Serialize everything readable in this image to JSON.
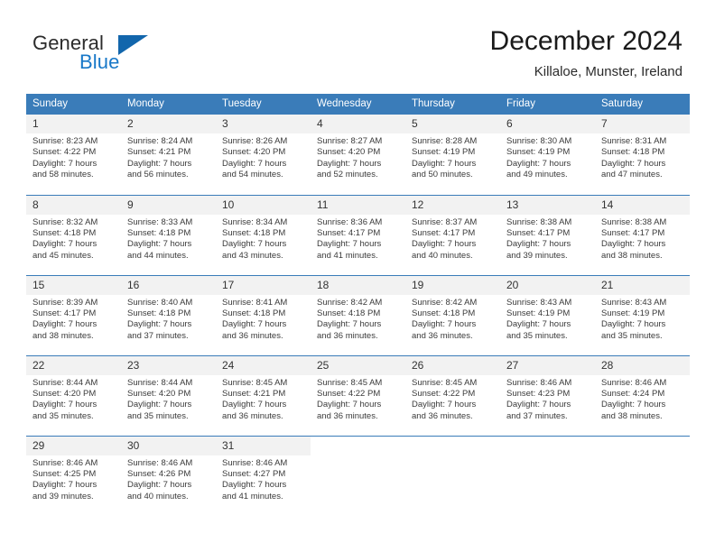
{
  "logo": {
    "line1": "General",
    "line2": "Blue",
    "triangle_color": "#1266ac",
    "blue_color": "#1878c8"
  },
  "header": {
    "title": "December 2024",
    "location": "Killaloe, Munster, Ireland"
  },
  "theme": {
    "header_blue": "#3a7cb9",
    "daynum_band": "#f2f2f2",
    "separator": "#3a7cb9"
  },
  "weekdays": [
    "Sunday",
    "Monday",
    "Tuesday",
    "Wednesday",
    "Thursday",
    "Friday",
    "Saturday"
  ],
  "weeks": [
    [
      {
        "day": "1",
        "sunrise": "Sunrise: 8:23 AM",
        "sunset": "Sunset: 4:22 PM",
        "daylight1": "Daylight: 7 hours",
        "daylight2": "and 58 minutes."
      },
      {
        "day": "2",
        "sunrise": "Sunrise: 8:24 AM",
        "sunset": "Sunset: 4:21 PM",
        "daylight1": "Daylight: 7 hours",
        "daylight2": "and 56 minutes."
      },
      {
        "day": "3",
        "sunrise": "Sunrise: 8:26 AM",
        "sunset": "Sunset: 4:20 PM",
        "daylight1": "Daylight: 7 hours",
        "daylight2": "and 54 minutes."
      },
      {
        "day": "4",
        "sunrise": "Sunrise: 8:27 AM",
        "sunset": "Sunset: 4:20 PM",
        "daylight1": "Daylight: 7 hours",
        "daylight2": "and 52 minutes."
      },
      {
        "day": "5",
        "sunrise": "Sunrise: 8:28 AM",
        "sunset": "Sunset: 4:19 PM",
        "daylight1": "Daylight: 7 hours",
        "daylight2": "and 50 minutes."
      },
      {
        "day": "6",
        "sunrise": "Sunrise: 8:30 AM",
        "sunset": "Sunset: 4:19 PM",
        "daylight1": "Daylight: 7 hours",
        "daylight2": "and 49 minutes."
      },
      {
        "day": "7",
        "sunrise": "Sunrise: 8:31 AM",
        "sunset": "Sunset: 4:18 PM",
        "daylight1": "Daylight: 7 hours",
        "daylight2": "and 47 minutes."
      }
    ],
    [
      {
        "day": "8",
        "sunrise": "Sunrise: 8:32 AM",
        "sunset": "Sunset: 4:18 PM",
        "daylight1": "Daylight: 7 hours",
        "daylight2": "and 45 minutes."
      },
      {
        "day": "9",
        "sunrise": "Sunrise: 8:33 AM",
        "sunset": "Sunset: 4:18 PM",
        "daylight1": "Daylight: 7 hours",
        "daylight2": "and 44 minutes."
      },
      {
        "day": "10",
        "sunrise": "Sunrise: 8:34 AM",
        "sunset": "Sunset: 4:18 PM",
        "daylight1": "Daylight: 7 hours",
        "daylight2": "and 43 minutes."
      },
      {
        "day": "11",
        "sunrise": "Sunrise: 8:36 AM",
        "sunset": "Sunset: 4:17 PM",
        "daylight1": "Daylight: 7 hours",
        "daylight2": "and 41 minutes."
      },
      {
        "day": "12",
        "sunrise": "Sunrise: 8:37 AM",
        "sunset": "Sunset: 4:17 PM",
        "daylight1": "Daylight: 7 hours",
        "daylight2": "and 40 minutes."
      },
      {
        "day": "13",
        "sunrise": "Sunrise: 8:38 AM",
        "sunset": "Sunset: 4:17 PM",
        "daylight1": "Daylight: 7 hours",
        "daylight2": "and 39 minutes."
      },
      {
        "day": "14",
        "sunrise": "Sunrise: 8:38 AM",
        "sunset": "Sunset: 4:17 PM",
        "daylight1": "Daylight: 7 hours",
        "daylight2": "and 38 minutes."
      }
    ],
    [
      {
        "day": "15",
        "sunrise": "Sunrise: 8:39 AM",
        "sunset": "Sunset: 4:17 PM",
        "daylight1": "Daylight: 7 hours",
        "daylight2": "and 38 minutes."
      },
      {
        "day": "16",
        "sunrise": "Sunrise: 8:40 AM",
        "sunset": "Sunset: 4:18 PM",
        "daylight1": "Daylight: 7 hours",
        "daylight2": "and 37 minutes."
      },
      {
        "day": "17",
        "sunrise": "Sunrise: 8:41 AM",
        "sunset": "Sunset: 4:18 PM",
        "daylight1": "Daylight: 7 hours",
        "daylight2": "and 36 minutes."
      },
      {
        "day": "18",
        "sunrise": "Sunrise: 8:42 AM",
        "sunset": "Sunset: 4:18 PM",
        "daylight1": "Daylight: 7 hours",
        "daylight2": "and 36 minutes."
      },
      {
        "day": "19",
        "sunrise": "Sunrise: 8:42 AM",
        "sunset": "Sunset: 4:18 PM",
        "daylight1": "Daylight: 7 hours",
        "daylight2": "and 36 minutes."
      },
      {
        "day": "20",
        "sunrise": "Sunrise: 8:43 AM",
        "sunset": "Sunset: 4:19 PM",
        "daylight1": "Daylight: 7 hours",
        "daylight2": "and 35 minutes."
      },
      {
        "day": "21",
        "sunrise": "Sunrise: 8:43 AM",
        "sunset": "Sunset: 4:19 PM",
        "daylight1": "Daylight: 7 hours",
        "daylight2": "and 35 minutes."
      }
    ],
    [
      {
        "day": "22",
        "sunrise": "Sunrise: 8:44 AM",
        "sunset": "Sunset: 4:20 PM",
        "daylight1": "Daylight: 7 hours",
        "daylight2": "and 35 minutes."
      },
      {
        "day": "23",
        "sunrise": "Sunrise: 8:44 AM",
        "sunset": "Sunset: 4:20 PM",
        "daylight1": "Daylight: 7 hours",
        "daylight2": "and 35 minutes."
      },
      {
        "day": "24",
        "sunrise": "Sunrise: 8:45 AM",
        "sunset": "Sunset: 4:21 PM",
        "daylight1": "Daylight: 7 hours",
        "daylight2": "and 36 minutes."
      },
      {
        "day": "25",
        "sunrise": "Sunrise: 8:45 AM",
        "sunset": "Sunset: 4:22 PM",
        "daylight1": "Daylight: 7 hours",
        "daylight2": "and 36 minutes."
      },
      {
        "day": "26",
        "sunrise": "Sunrise: 8:45 AM",
        "sunset": "Sunset: 4:22 PM",
        "daylight1": "Daylight: 7 hours",
        "daylight2": "and 36 minutes."
      },
      {
        "day": "27",
        "sunrise": "Sunrise: 8:46 AM",
        "sunset": "Sunset: 4:23 PM",
        "daylight1": "Daylight: 7 hours",
        "daylight2": "and 37 minutes."
      },
      {
        "day": "28",
        "sunrise": "Sunrise: 8:46 AM",
        "sunset": "Sunset: 4:24 PM",
        "daylight1": "Daylight: 7 hours",
        "daylight2": "and 38 minutes."
      }
    ],
    [
      {
        "day": "29",
        "sunrise": "Sunrise: 8:46 AM",
        "sunset": "Sunset: 4:25 PM",
        "daylight1": "Daylight: 7 hours",
        "daylight2": "and 39 minutes."
      },
      {
        "day": "30",
        "sunrise": "Sunrise: 8:46 AM",
        "sunset": "Sunset: 4:26 PM",
        "daylight1": "Daylight: 7 hours",
        "daylight2": "and 40 minutes."
      },
      {
        "day": "31",
        "sunrise": "Sunrise: 8:46 AM",
        "sunset": "Sunset: 4:27 PM",
        "daylight1": "Daylight: 7 hours",
        "daylight2": "and 41 minutes."
      },
      null,
      null,
      null,
      null
    ]
  ]
}
